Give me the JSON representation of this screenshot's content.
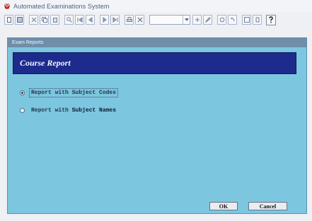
{
  "app": {
    "title": "Automated Examinations System",
    "icon": "app-logo-icon"
  },
  "toolbar": {
    "buttons": [
      "new-icon",
      "save-icon",
      "cut-icon",
      "copy-icon",
      "paste-icon",
      "find-icon",
      "first-icon",
      "prev-icon",
      "next-icon",
      "last-icon",
      "print-icon",
      "delete-icon"
    ],
    "combo_value": "",
    "right_buttons": [
      "add-icon",
      "edit-icon",
      "refresh-icon",
      "close-icon"
    ],
    "help_icon": "help-icon"
  },
  "window": {
    "title": "Exam Reports",
    "header": "Course Report",
    "options": [
      {
        "label_a": "Report with ",
        "label_b": "Subject Codes",
        "selected": true
      },
      {
        "label_a": "Report with ",
        "label_b": "Subject Names",
        "selected": false
      }
    ],
    "ok_label": "OK",
    "cancel_label": "Cancel",
    "colors": {
      "background": "#7cc6e0",
      "header": "#1d2b8c"
    }
  }
}
